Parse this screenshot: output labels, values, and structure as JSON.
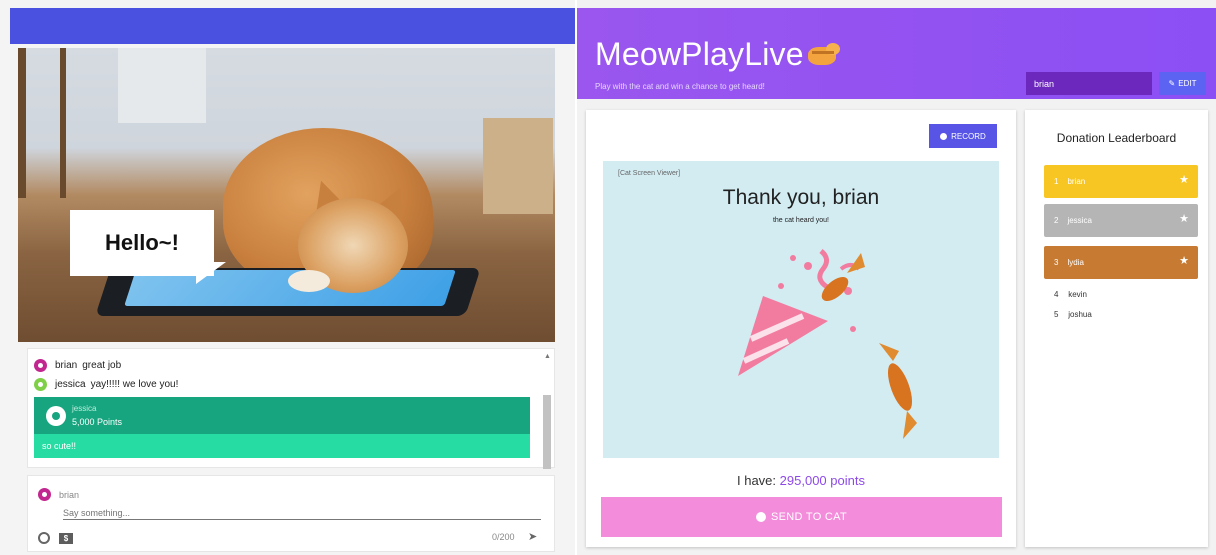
{
  "left": {
    "video": {
      "speech_bubble": "Hello~!"
    },
    "chat": {
      "messages": [
        {
          "user": "brian",
          "text": "great job",
          "avatar_color": "#c2268f"
        },
        {
          "user": "jessica",
          "text": "yay!!!!! we love you!",
          "avatar_color": "#7fcf47"
        }
      ],
      "donation": {
        "user": "jessica",
        "points": "5,000 Points",
        "message": "so cute!!",
        "colors": {
          "top": "#16a57f",
          "bottom": "#27dca2"
        }
      }
    },
    "composer": {
      "user": "brian",
      "placeholder": "Say something...",
      "char_count": "0/200",
      "dollar_icon": "$"
    }
  },
  "right": {
    "header": {
      "title": "MeowPlayLive",
      "tagline": "Play with the cat and win a chance to get heard!",
      "name_value": "brian",
      "edit_label": "EDIT"
    },
    "main": {
      "record_label": "RECORD",
      "viewer_label": "[Cat Screen Viewer]",
      "viewer_title": "Thank you, brian",
      "viewer_subtitle": "the cat heard you!",
      "points_prefix": "I have:",
      "points_value": "295,000",
      "points_unit": "points",
      "send_label": "SEND TO CAT"
    },
    "leaderboard": {
      "title": "Donation Leaderboard",
      "top": [
        {
          "rank": "1",
          "name": "brian",
          "color": "#f8c623"
        },
        {
          "rank": "2",
          "name": "jessica",
          "color": "#b5b5b5"
        },
        {
          "rank": "3",
          "name": "lydia",
          "color": "#c77a31"
        }
      ],
      "rest": [
        {
          "rank": "4",
          "name": "kevin"
        },
        {
          "rank": "5",
          "name": "joshua"
        }
      ]
    }
  },
  "colors": {
    "left_bar": "#4a50e0",
    "header": "#9a56ee",
    "record": "#5754e6",
    "send": "#f38ddb",
    "points": "#8e4ae8"
  },
  "icons": [
    "cat-emoji-icon",
    "pencil-icon",
    "record-dot-icon",
    "paw-icon",
    "star-icon",
    "emoji-icon",
    "dollar-icon",
    "send-plane-icon",
    "user-avatar-icon",
    "party-popper-icon",
    "goldfish-icon"
  ]
}
